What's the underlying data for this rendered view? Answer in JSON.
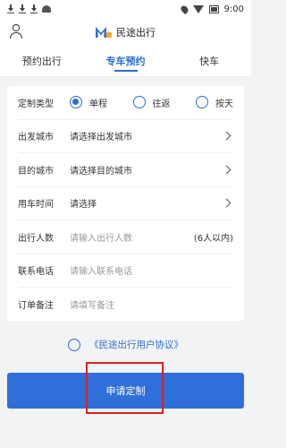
{
  "status_bar": {
    "time": "9:00"
  },
  "header": {
    "brand_name": "民途出行"
  },
  "tabs": [
    {
      "label": "预约出行",
      "active": false
    },
    {
      "label": "专车预约",
      "active": true
    },
    {
      "label": "快车",
      "active": false
    }
  ],
  "form": {
    "custom_type": {
      "label": "定制类型",
      "options": [
        "单程",
        "往返",
        "按天"
      ],
      "selected": "单程"
    },
    "departure_city": {
      "label": "出发城市",
      "value": "请选择出发城市"
    },
    "destination_city": {
      "label": "目的城市",
      "value": "请选择目的城市"
    },
    "use_time": {
      "label": "用车时间",
      "value": "请选择"
    },
    "passengers": {
      "label": "出行人数",
      "placeholder": "请输入出行人数",
      "hint": "(6人以内)"
    },
    "phone": {
      "label": "联系电话",
      "placeholder": "请输入联系电话"
    },
    "note": {
      "label": "订单备注",
      "placeholder": "请填写备注"
    }
  },
  "agreement": {
    "link_text": "《民途出行用户协议》",
    "checked": false
  },
  "submit": {
    "label": "申请定制"
  },
  "colors": {
    "accent": "#2b6dd6",
    "logo_orange": "#f5a623",
    "highlight": "#e02020"
  }
}
